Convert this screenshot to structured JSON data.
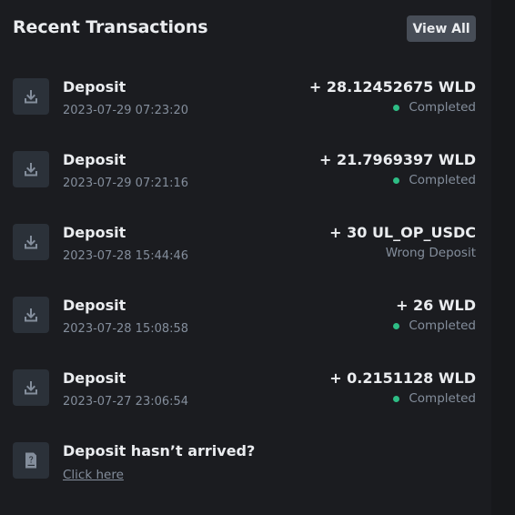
{
  "header": {
    "title": "Recent Transactions",
    "view_all_label": "View All"
  },
  "colors": {
    "background": "#1b1c20",
    "icon_tile": "#2b3139",
    "button_bg": "#474d57",
    "text_primary": "#eaecef",
    "text_secondary": "#848e9c",
    "status_completed": "#2ebd85"
  },
  "transactions": [
    {
      "type": "Deposit",
      "time": "2023-07-29 07:23:20",
      "amount": "+ 28.12452675 WLD",
      "status": "Completed",
      "status_dot": true,
      "icon": "download-icon"
    },
    {
      "type": "Deposit",
      "time": "2023-07-29 07:21:16",
      "amount": "+ 21.7969397 WLD",
      "status": "Completed",
      "status_dot": true,
      "icon": "download-icon"
    },
    {
      "type": "Deposit",
      "time": "2023-07-28 15:44:46",
      "amount": "+ 30 UL_OP_USDC",
      "status": "Wrong Deposit",
      "status_dot": false,
      "icon": "download-icon"
    },
    {
      "type": "Deposit",
      "time": "2023-07-28 15:08:58",
      "amount": "+ 26 WLD",
      "status": "Completed",
      "status_dot": true,
      "icon": "download-icon"
    },
    {
      "type": "Deposit",
      "time": "2023-07-27 23:06:54",
      "amount": "+ 0.2151128 WLD",
      "status": "Completed",
      "status_dot": true,
      "icon": "download-icon"
    }
  ],
  "help": {
    "title": "Deposit hasn’t arrived?",
    "link_label": "Click here",
    "icon": "question-document-icon"
  }
}
